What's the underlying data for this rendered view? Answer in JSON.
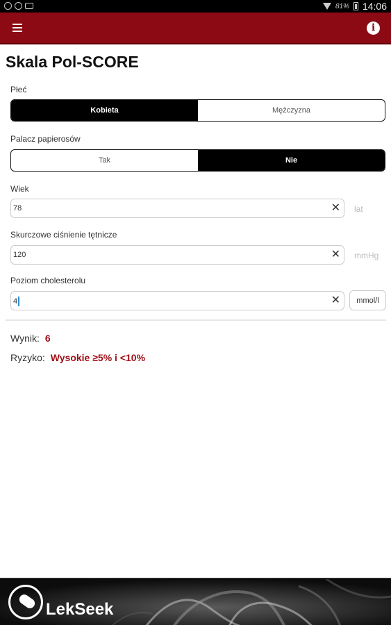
{
  "status_bar": {
    "battery": "81%",
    "time": "14:06"
  },
  "app_bar": {
    "menu_icon": "menu-icon",
    "info_icon": "info-icon",
    "info_glyph": "i"
  },
  "page": {
    "title": "Skala Pol-SCORE"
  },
  "sex": {
    "label": "Płeć",
    "options": [
      "Kobieta",
      "Mężczyzna"
    ],
    "selected": "Kobieta"
  },
  "smoker": {
    "label": "Palacz papierosów",
    "options": [
      "Tak",
      "Nie"
    ],
    "selected": "Nie"
  },
  "age": {
    "label": "Wiek",
    "value": "78",
    "unit": "lat"
  },
  "blood_pressure": {
    "label": "Skurczowe ciśnienie tętnicze",
    "value": "120",
    "unit": "mmHg"
  },
  "cholesterol": {
    "label": "Poziom cholesterolu",
    "value": "4",
    "unit": "mmol/l"
  },
  "clear_glyph": "✕",
  "result": {
    "score_label": "Wynik:",
    "score_value": "6",
    "risk_label": "Ryzyko:",
    "risk_value": "Wysokie ≥5% i <10%"
  },
  "banner": {
    "logo_text": "LekSeek"
  },
  "colors": {
    "app_bar": "#8b0a14",
    "accent_text": "#a01018",
    "segment_active": "#000000"
  }
}
